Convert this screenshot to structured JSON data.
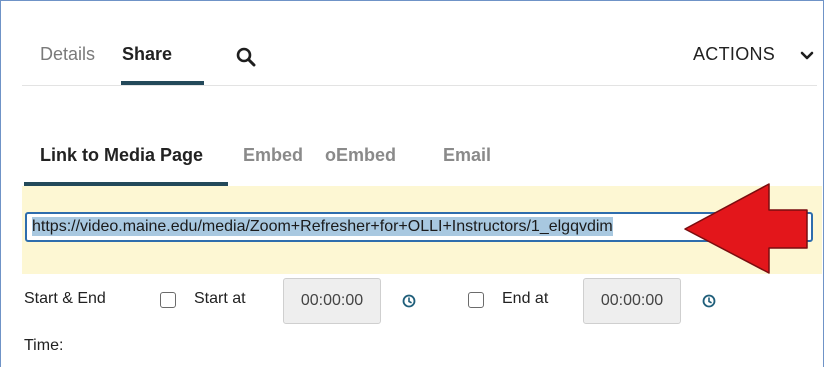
{
  "tabs": {
    "details": "Details",
    "share": "Share"
  },
  "actions": {
    "label": "ACTIONS"
  },
  "share_tabs": {
    "link_to_media_page": "Link to Media Page",
    "embed": "Embed",
    "oembed": "oEmbed",
    "email": "Email"
  },
  "link": {
    "url": "https://video.maine.edu/media/Zoom+Refresher+for+OLLI+Instructors/1_elgqvdim"
  },
  "start_end": {
    "label_line1": "Start & End",
    "label_line2": "Time:",
    "start_label": "Start at",
    "start_value": "00:00:00",
    "end_label": "End at",
    "end_value": "00:00:00"
  },
  "colors": {
    "accent": "#23495a",
    "highlight_band": "#fdf7d3",
    "selection": "#a8c8e0",
    "input_border": "#2e6dad",
    "arrow": "#e3161b",
    "clock_icon": "#1f5e7a"
  },
  "icons": [
    "search-icon",
    "chevron-down-icon",
    "red-arrow-annotation",
    "clock-icon"
  ]
}
